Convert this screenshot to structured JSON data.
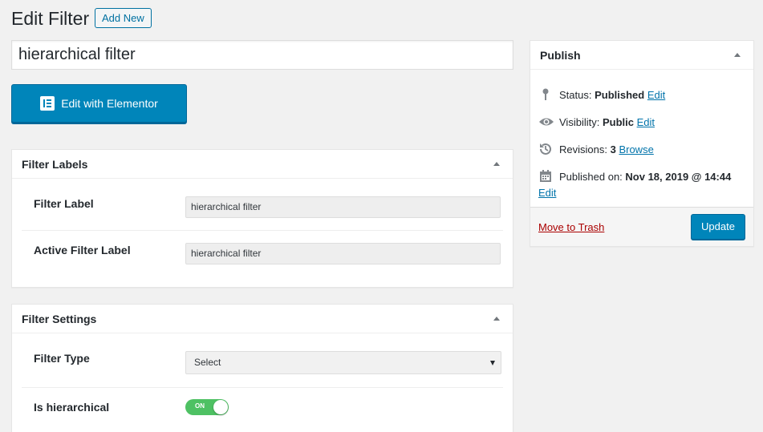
{
  "header": {
    "title": "Edit Filter",
    "add_new": "Add New"
  },
  "post_title": {
    "value": "hierarchical filter"
  },
  "elementor": {
    "label": "Edit with Elementor"
  },
  "filter_labels": {
    "title": "Filter Labels",
    "filter_label": {
      "label": "Filter Label",
      "value": "hierarchical filter"
    },
    "active_filter_label": {
      "label": "Active Filter Label",
      "value": "hierarchical filter"
    }
  },
  "filter_settings": {
    "title": "Filter Settings",
    "filter_type": {
      "label": "Filter Type",
      "value": "Select"
    },
    "is_hierarchical": {
      "label": "Is hierarchical",
      "state": "ON"
    }
  },
  "publish": {
    "title": "Publish",
    "status": {
      "label": "Status:",
      "value": "Published",
      "action": "Edit"
    },
    "visibility": {
      "label": "Visibility:",
      "value": "Public",
      "action": "Edit"
    },
    "revisions": {
      "label": "Revisions:",
      "value": "3",
      "action": "Browse"
    },
    "published_on": {
      "label": "Published on:",
      "value": "Nov 18, 2019 @ 14:44",
      "action": "Edit"
    },
    "trash": "Move to Trash",
    "update": "Update"
  },
  "colors": {
    "primary": "#0085ba",
    "link": "#0073aa",
    "danger": "#a00000",
    "toggle_on": "#4ec163"
  }
}
